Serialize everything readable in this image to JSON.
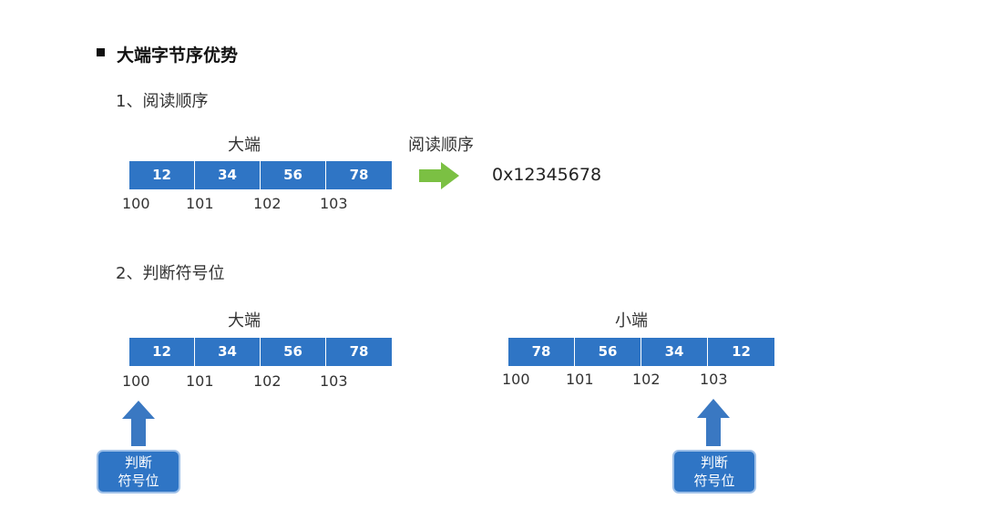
{
  "heading": "大端字节序优势",
  "sections": [
    {
      "label": "1、阅读顺序"
    },
    {
      "label": "2、判断符号位"
    }
  ],
  "section1": {
    "endian_label": "大端",
    "cells": [
      "12",
      "34",
      "56",
      "78"
    ],
    "addresses": [
      "100",
      "101",
      "102",
      "103"
    ],
    "arrow_label": "阅读顺序",
    "result": "0x12345678"
  },
  "section2": {
    "big": {
      "endian_label": "大端",
      "cells": [
        "12",
        "34",
        "56",
        "78"
      ],
      "addresses": [
        "100",
        "101",
        "102",
        "103"
      ]
    },
    "little": {
      "endian_label": "小端",
      "cells": [
        "78",
        "56",
        "34",
        "12"
      ],
      "addresses": [
        "100",
        "101",
        "102",
        "103"
      ]
    },
    "sign_label_line1": "判断",
    "sign_label_line2": "符号位"
  },
  "colors": {
    "cell_blue": "#2f75c5",
    "arrow_blue": "#3a78c2",
    "arrow_green": "#7bc043"
  }
}
